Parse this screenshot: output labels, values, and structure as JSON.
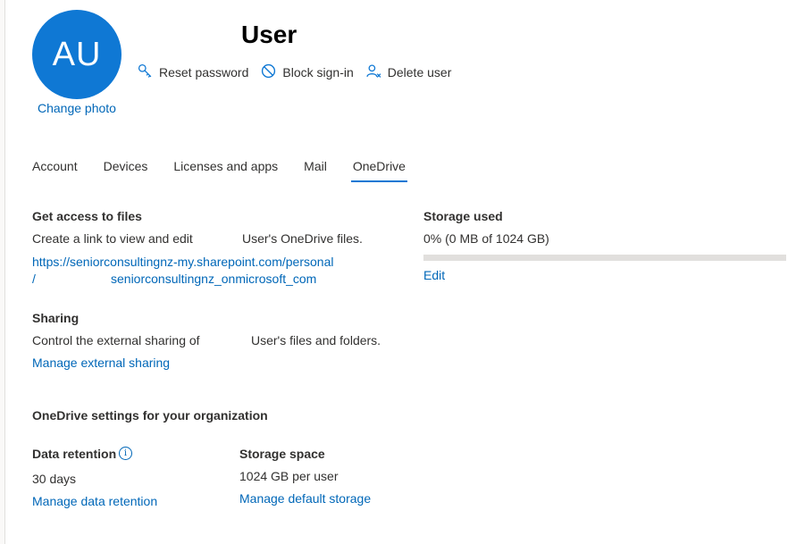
{
  "header": {
    "avatar_initials": "AU",
    "change_photo": "Change photo",
    "title": "User"
  },
  "actions": {
    "reset_password": "Reset password",
    "block_signin": "Block sign-in",
    "delete_user": "Delete user"
  },
  "tabs": [
    {
      "label": "Account"
    },
    {
      "label": "Devices"
    },
    {
      "label": "Licenses and apps"
    },
    {
      "label": "Mail"
    },
    {
      "label": "OneDrive",
      "active": true
    }
  ],
  "files": {
    "title": "Get access to files",
    "desc": "Create a link to view and edit",
    "desc_suffix": "User's OneDrive files.",
    "link_line1": "https://seniorconsultingnz-my.sharepoint.com/personal",
    "link_line2_prefix": "/",
    "link_line2": "seniorconsultingnz_onmicrosoft_com"
  },
  "storage": {
    "title": "Storage used",
    "value": "0% (0 MB of 1024 GB)",
    "used_fraction": 0,
    "edit": "Edit"
  },
  "sharing": {
    "title": "Sharing",
    "desc": "Control the external sharing of",
    "desc_suffix": "User's files and folders.",
    "manage": "Manage external sharing"
  },
  "org": {
    "title": "OneDrive settings for your organization",
    "retention_title": "Data retention",
    "retention_value": "30 days",
    "retention_link": "Manage data retention",
    "space_title": "Storage space",
    "space_value": "1024 GB per user",
    "space_link": "Manage default storage"
  },
  "colors": {
    "accent": "#0f78d4",
    "link": "#0067b8"
  },
  "icons": {
    "reset_password": "key-icon",
    "block_signin": "block-icon",
    "delete_user": "delete-user-icon",
    "info": "info-icon"
  }
}
